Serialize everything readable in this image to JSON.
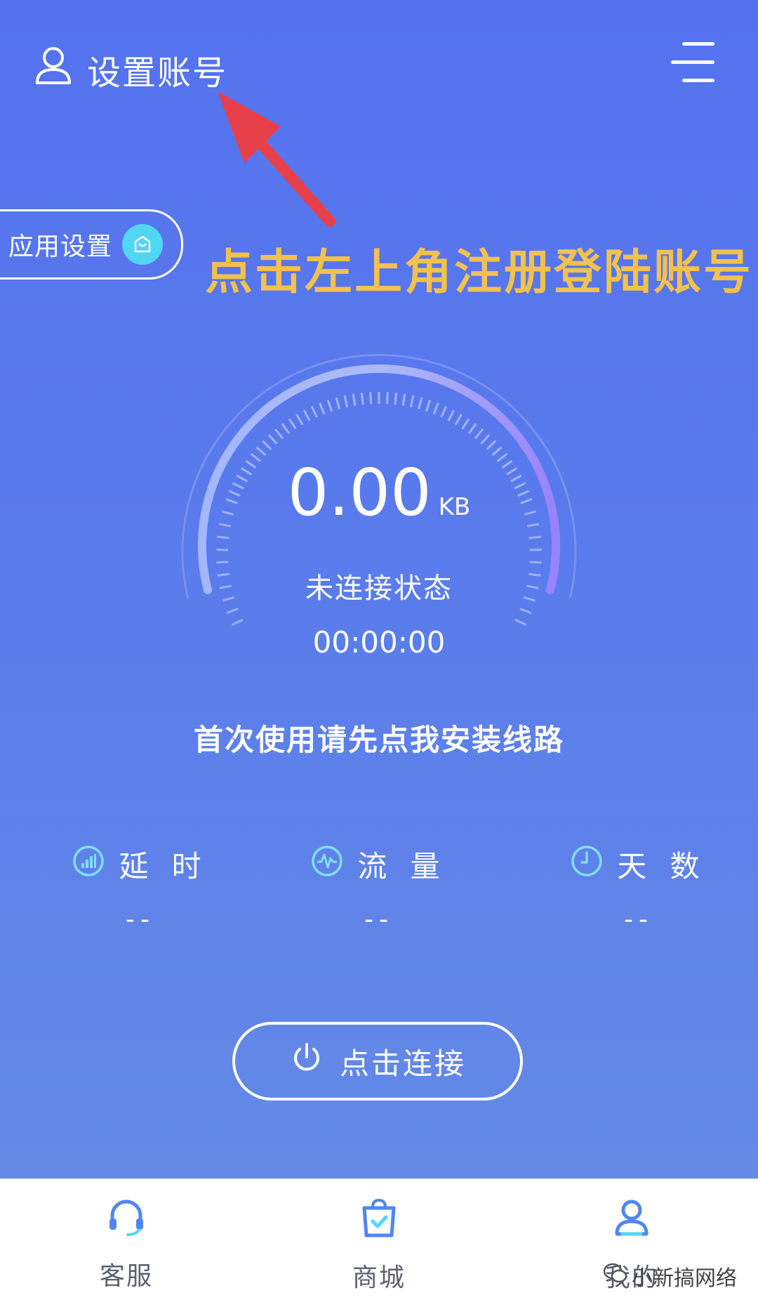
{
  "header": {
    "account_label": "设置账号"
  },
  "annotation": {
    "text": "点击左上角注册登陆账号"
  },
  "app_settings": {
    "label": "应用设置"
  },
  "gauge": {
    "value": "0.00",
    "unit": "KB",
    "status": "未连接状态",
    "timer": "00:00:00"
  },
  "install_hint": "首次使用请先点我安装线路",
  "stats": [
    {
      "label": "延 时",
      "value": "--",
      "icon": "signal-icon"
    },
    {
      "label": "流 量",
      "value": "--",
      "icon": "pulse-icon"
    },
    {
      "label": "天 数",
      "value": "--",
      "icon": "clock-icon"
    }
  ],
  "connect_button": {
    "label": "点击连接"
  },
  "tabs": [
    {
      "label": "客服",
      "icon": "headset-icon"
    },
    {
      "label": "商城",
      "icon": "shopping-bag-icon"
    },
    {
      "label": "我的",
      "icon": "user-icon"
    }
  ],
  "watermark": {
    "text": "小新搞网络"
  },
  "colors": {
    "background": "#5472ef",
    "accent_cyan": "#51d6f3",
    "annotation": "#f2c14e",
    "arrow": "#e8404a"
  }
}
